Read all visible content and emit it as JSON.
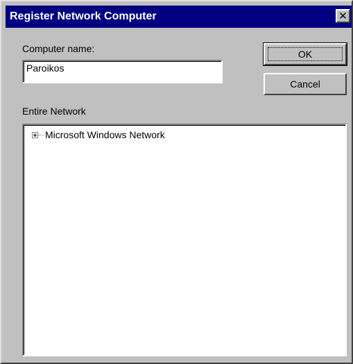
{
  "window": {
    "title": "Register Network Computer",
    "close_glyph": "✕"
  },
  "form": {
    "computer_name_label": "Computer name:",
    "computer_name_value": "Paroikos",
    "network_label": "Entire Network"
  },
  "buttons": {
    "ok_label": "OK",
    "cancel_label": "Cancel"
  },
  "tree": {
    "items": [
      {
        "label": "Microsoft Windows Network",
        "expanded": false
      }
    ]
  },
  "colors": {
    "titlebar": "#000080",
    "face": "#c0c0c0"
  }
}
